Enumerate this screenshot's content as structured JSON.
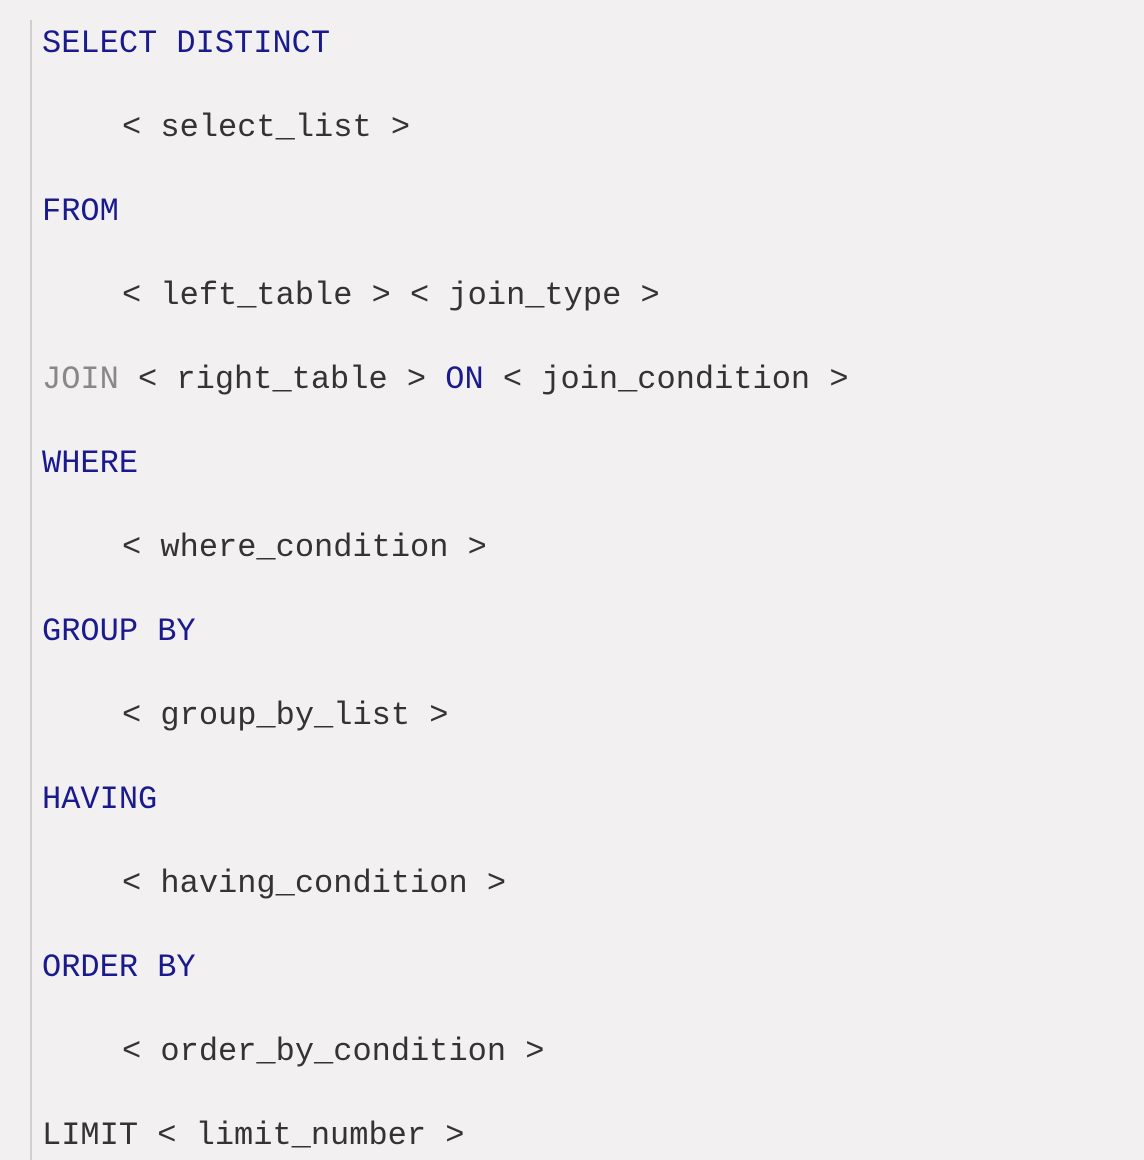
{
  "sql": {
    "line1": {
      "keyword": "SELECT DISTINCT"
    },
    "line2": {
      "placeholder": "< select_list >"
    },
    "line3": {
      "keyword": "FROM"
    },
    "line4": {
      "placeholder": "< left_table > < join_type >"
    },
    "line5": {
      "dim_keyword": "JOIN",
      "placeholder1": " < right_table > ",
      "keyword": "ON",
      "placeholder2": " < join_condition >"
    },
    "line6": {
      "keyword": "WHERE"
    },
    "line7": {
      "placeholder": "< where_condition >"
    },
    "line8": {
      "keyword": "GROUP BY"
    },
    "line9": {
      "placeholder": "< group_by_list >"
    },
    "line10": {
      "keyword": "HAVING"
    },
    "line11": {
      "placeholder": "< having_condition >"
    },
    "line12": {
      "keyword": "ORDER BY"
    },
    "line13": {
      "placeholder": "< order_by_condition >"
    },
    "line14": {
      "keyword": "LIMIT",
      "placeholder": " < limit_number >"
    }
  }
}
